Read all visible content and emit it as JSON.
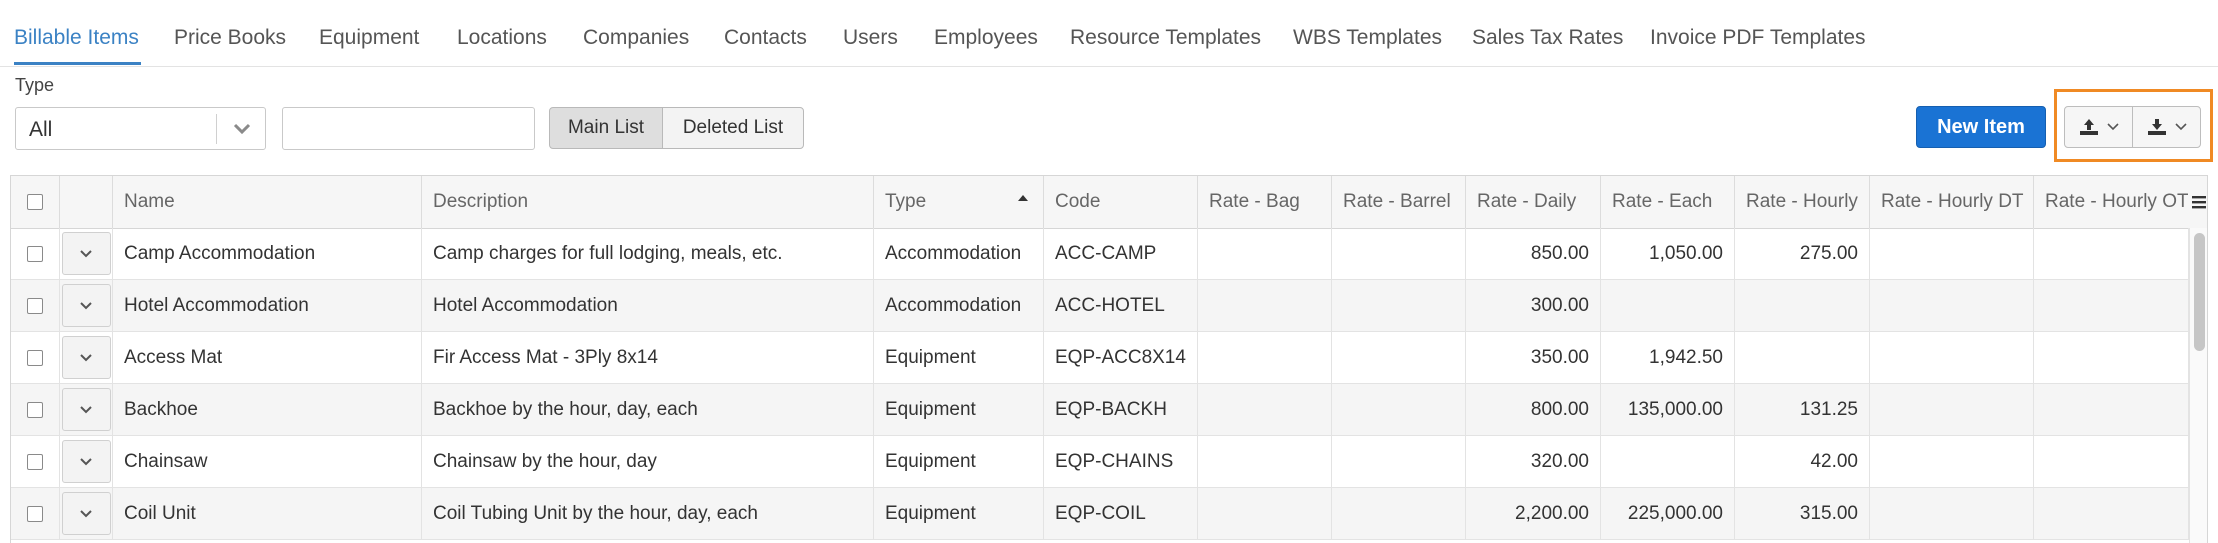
{
  "tabs": [
    {
      "label": "Billable Items",
      "active": true
    },
    {
      "label": "Price Books"
    },
    {
      "label": "Equipment"
    },
    {
      "label": "Locations"
    },
    {
      "label": "Companies"
    },
    {
      "label": "Contacts"
    },
    {
      "label": "Users"
    },
    {
      "label": "Employees"
    },
    {
      "label": "Resource Templates"
    },
    {
      "label": "WBS Templates"
    },
    {
      "label": "Sales Tax Rates"
    },
    {
      "label": "Invoice PDF Templates"
    }
  ],
  "filter": {
    "type_label": "Type",
    "type_value": "All",
    "search_value": "",
    "main_list_label": "Main List",
    "deleted_list_label": "Deleted List"
  },
  "toolbar": {
    "new_item_label": "New Item",
    "import_icon": "upload-icon",
    "export_icon": "download-icon",
    "accent_color": "#1a73d4",
    "highlight_color": "#f08a24"
  },
  "grid": {
    "columns": [
      "Name",
      "Description",
      "Type",
      "Code",
      "Rate - Bag",
      "Rate - Barrel",
      "Rate - Daily",
      "Rate - Each",
      "Rate - Hourly",
      "Rate - Hourly DT",
      "Rate - Hourly OT"
    ],
    "sorted_column": "Type",
    "sort_direction": "ascending",
    "rows": [
      {
        "name": "Camp Accommodation",
        "description": "Camp charges for full lodging, meals, etc.",
        "type": "Accommodation",
        "code": "ACC-CAMP",
        "rate_bag": "",
        "rate_barrel": "",
        "rate_daily": "850.00",
        "rate_each": "1,050.00",
        "rate_hourly": "275.00",
        "rate_hourly_dt": "",
        "rate_hourly_ot": ""
      },
      {
        "name": "Hotel Accommodation",
        "description": "Hotel Accommodation",
        "type": "Accommodation",
        "code": "ACC-HOTEL",
        "rate_bag": "",
        "rate_barrel": "",
        "rate_daily": "300.00",
        "rate_each": "",
        "rate_hourly": "",
        "rate_hourly_dt": "",
        "rate_hourly_ot": ""
      },
      {
        "name": "Access Mat",
        "description": "Fir Access Mat - 3Ply 8x14",
        "type": "Equipment",
        "code": "EQP-ACC8X14",
        "rate_bag": "",
        "rate_barrel": "",
        "rate_daily": "350.00",
        "rate_each": "1,942.50",
        "rate_hourly": "",
        "rate_hourly_dt": "",
        "rate_hourly_ot": ""
      },
      {
        "name": "Backhoe",
        "description": "Backhoe by the hour, day, each",
        "type": "Equipment",
        "code": "EQP-BACKH",
        "rate_bag": "",
        "rate_barrel": "",
        "rate_daily": "800.00",
        "rate_each": "135,000.00",
        "rate_hourly": "131.25",
        "rate_hourly_dt": "",
        "rate_hourly_ot": ""
      },
      {
        "name": "Chainsaw",
        "description": "Chainsaw by the hour, day",
        "type": "Equipment",
        "code": "EQP-CHAINS",
        "rate_bag": "",
        "rate_barrel": "",
        "rate_daily": "320.00",
        "rate_each": "",
        "rate_hourly": "42.00",
        "rate_hourly_dt": "",
        "rate_hourly_ot": ""
      },
      {
        "name": "Coil Unit",
        "description": "Coil Tubing Unit by the hour, day, each",
        "type": "Equipment",
        "code": "EQP-COIL",
        "rate_bag": "",
        "rate_barrel": "",
        "rate_daily": "2,200.00",
        "rate_each": "225,000.00",
        "rate_hourly": "315.00",
        "rate_hourly_dt": "",
        "rate_hourly_ot": ""
      }
    ]
  }
}
